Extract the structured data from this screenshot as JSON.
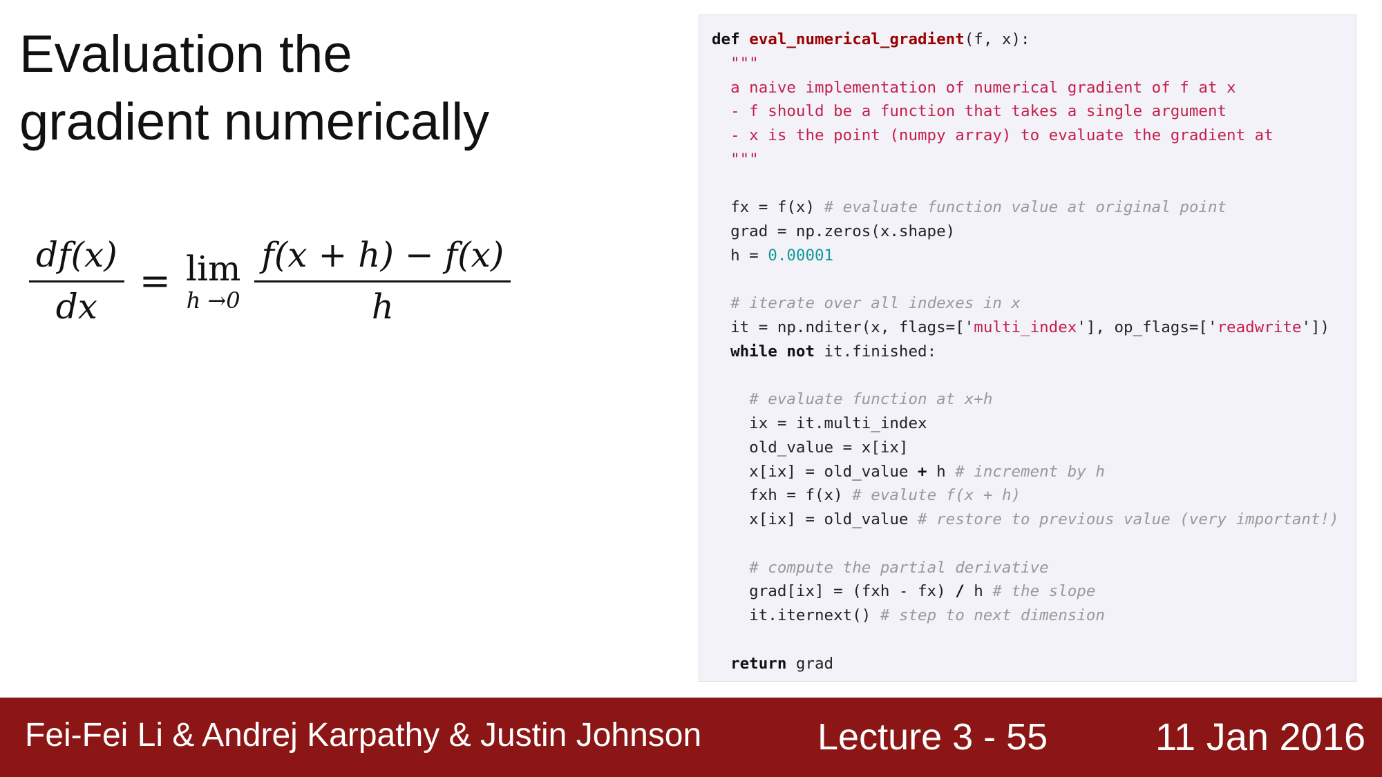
{
  "title": {
    "line1": "Evaluation the",
    "line2": "gradient numerically"
  },
  "formula": {
    "lhs_num": "df(x)",
    "lhs_den": "dx",
    "equals": "=",
    "lim": "lim",
    "lim_sub": "h →0",
    "rhs_num": "f(x + h) − f(x)",
    "rhs_den": "h"
  },
  "code": {
    "language": "python",
    "lines": [
      "def eval_numerical_gradient(f, x):",
      "  \"\"\"",
      "  a naive implementation of numerical gradient of f at x",
      "  - f should be a function that takes a single argument",
      "  - x is the point (numpy array) to evaluate the gradient at",
      "  \"\"\"",
      "",
      "  fx = f(x) # evaluate function value at original point",
      "  grad = np.zeros(x.shape)",
      "  h = 0.00001",
      "",
      "  # iterate over all indexes in x",
      "  it = np.nditer(x, flags=['multi_index'], op_flags=['readwrite'])",
      "  while not it.finished:",
      "",
      "    # evaluate function at x+h",
      "    ix = it.multi_index",
      "    old_value = x[ix]",
      "    x[ix] = old_value + h # increment by h",
      "    fxh = f(x) # evalute f(x + h)",
      "    x[ix] = old_value # restore to previous value (very important!)",
      "",
      "    # compute the partial derivative",
      "    grad[ix] = (fxh - fx) / h # the slope",
      "    it.iternext() # step to next dimension",
      "",
      "  return grad"
    ],
    "colors": {
      "background": "#f2f2f8",
      "keyword": "#111111",
      "function_name": "#990000",
      "docstring": "#c4204c",
      "comment": "#999999",
      "number": "#119999",
      "string": "#c4204c"
    }
  },
  "footer": {
    "authors": "Fei-Fei Li & Andrej Karpathy & Justin Johnson",
    "lecture": "Lecture 3 - 55",
    "date": "11 Jan 2016",
    "background_color": "#8c1515",
    "text_color": "#ffffff"
  }
}
